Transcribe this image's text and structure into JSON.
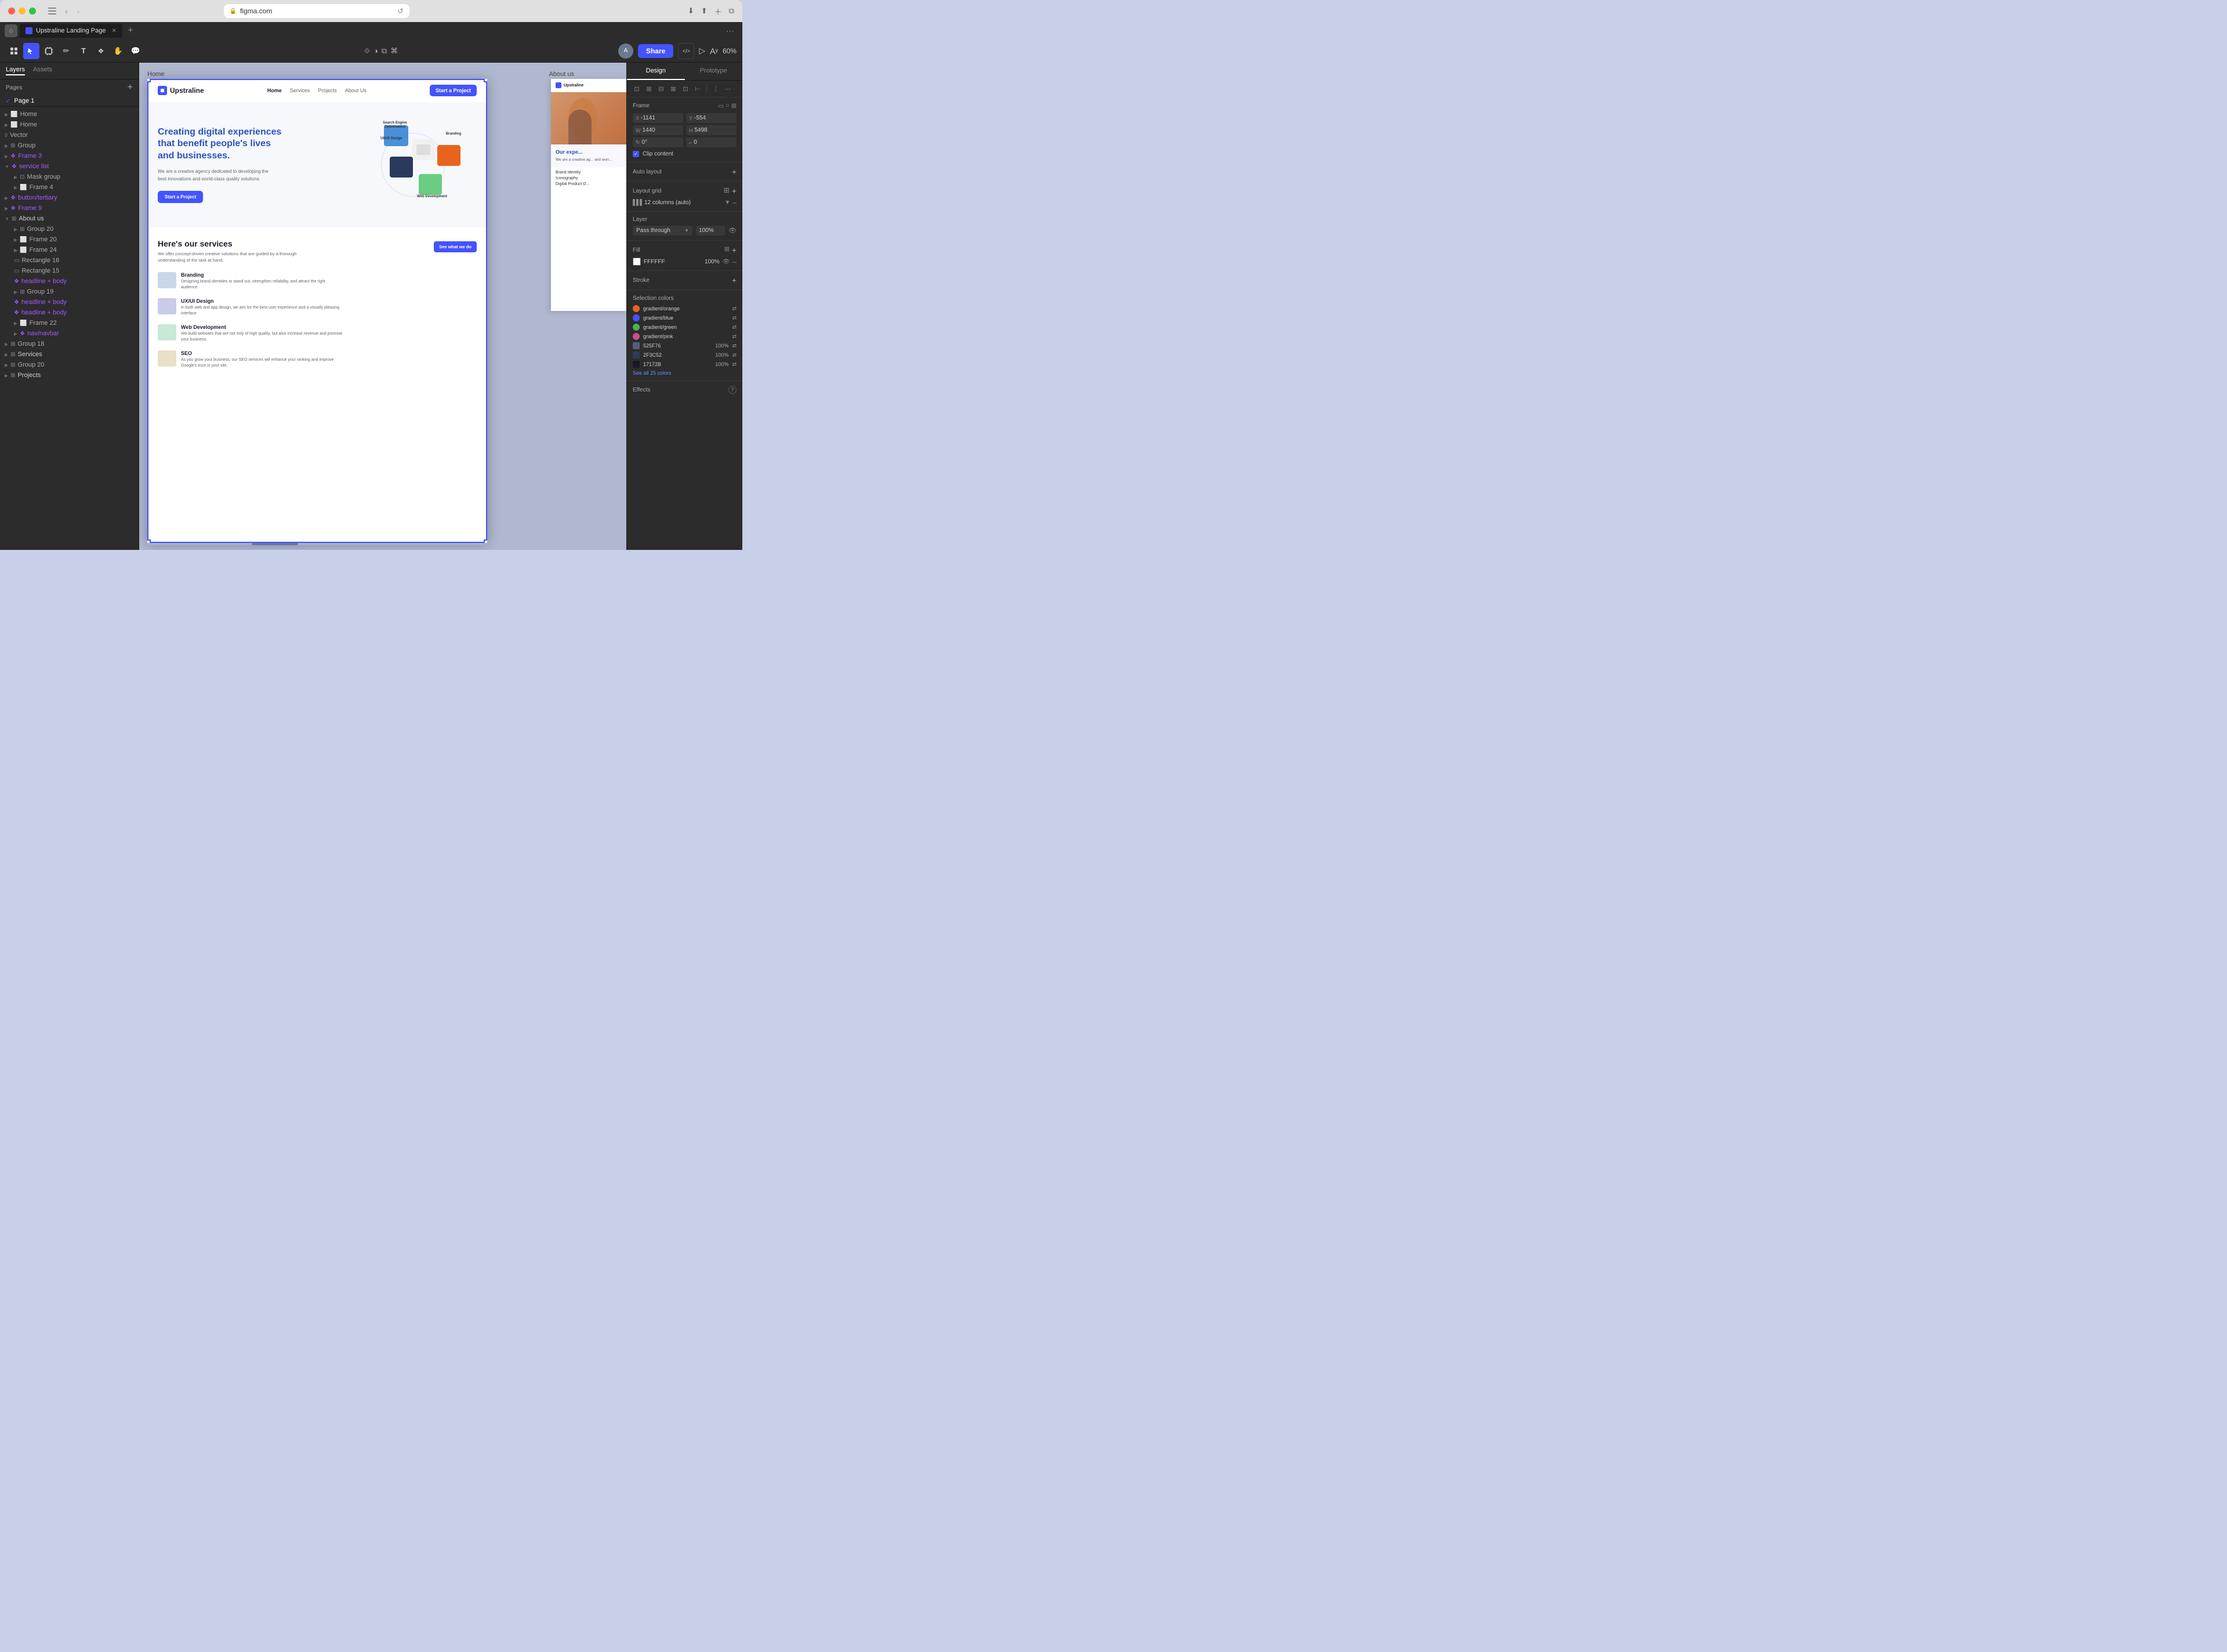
{
  "browser": {
    "url": "figma.com",
    "tab_title": "Upstraline Landing Page",
    "reload_icon": "↺"
  },
  "toolbar": {
    "tool_select": "▲",
    "tool_frame": "⬜",
    "tool_pen": "✏",
    "tool_text": "T",
    "tool_component": "❖",
    "tool_hand": "✋",
    "tool_comment": "💬",
    "share_label": "Share",
    "zoom_label": "60%",
    "present_icon": "▷",
    "code_icon": "</>",
    "avatar_label": "A"
  },
  "left_panel": {
    "tabs": [
      "Layers",
      "Assets"
    ],
    "current_page": "Page 1",
    "pages_label": "Pages",
    "layers": [
      {
        "id": "home1",
        "label": "Home",
        "icon": "frame",
        "indent": 0
      },
      {
        "id": "home2",
        "label": "Home",
        "icon": "frame",
        "indent": 0
      },
      {
        "id": "vector",
        "label": "Vector",
        "icon": "path",
        "indent": 0
      },
      {
        "id": "group",
        "label": "Group",
        "icon": "group",
        "indent": 0
      },
      {
        "id": "frame3",
        "label": "Frame 3",
        "icon": "component",
        "indent": 0
      },
      {
        "id": "service_list",
        "label": "service list",
        "icon": "component",
        "indent": 0
      },
      {
        "id": "mask_group",
        "label": "Mask group",
        "icon": "group",
        "indent": 1
      },
      {
        "id": "frame4",
        "label": "Frame 4",
        "icon": "frame",
        "indent": 1
      },
      {
        "id": "button_tertiary",
        "label": "button/tertiary",
        "icon": "component",
        "indent": 0
      },
      {
        "id": "frame9",
        "label": "Frame 9",
        "icon": "component",
        "indent": 0
      },
      {
        "id": "about_us",
        "label": "About us",
        "icon": "group",
        "indent": 0
      },
      {
        "id": "group20",
        "label": "Group 20",
        "icon": "group",
        "indent": 1
      },
      {
        "id": "frame20",
        "label": "Frame 20",
        "icon": "frame",
        "indent": 1
      },
      {
        "id": "frame24",
        "label": "Frame 24",
        "icon": "frame",
        "indent": 1
      },
      {
        "id": "rect16",
        "label": "Rectangle 16",
        "icon": "rect",
        "indent": 1
      },
      {
        "id": "rect15",
        "label": "Rectangle 15",
        "icon": "rect",
        "indent": 1
      },
      {
        "id": "headline_body",
        "label": "headline + body",
        "icon": "component",
        "indent": 1
      },
      {
        "id": "group19",
        "label": "Group 19",
        "icon": "group",
        "indent": 1
      },
      {
        "id": "headline_body2",
        "label": "headline + body",
        "icon": "component",
        "indent": 1
      },
      {
        "id": "headline_body3",
        "label": "headline + body",
        "icon": "component",
        "indent": 1
      },
      {
        "id": "frame22",
        "label": "Frame 22",
        "icon": "frame",
        "indent": 1
      },
      {
        "id": "nav_navbar",
        "label": "nav/navbar",
        "icon": "component",
        "indent": 1
      },
      {
        "id": "group18",
        "label": "Group 18",
        "icon": "group",
        "indent": 0
      },
      {
        "id": "services",
        "label": "Services",
        "icon": "group",
        "indent": 0
      },
      {
        "id": "group20b",
        "label": "Group 20",
        "icon": "group",
        "indent": 0
      },
      {
        "id": "projects",
        "label": "Projects",
        "icon": "group",
        "indent": 0
      }
    ]
  },
  "canvas": {
    "frame_label": "Home",
    "frame2_label": "About us"
  },
  "site": {
    "logo_text": "Upstraline",
    "nav_items": [
      "Home",
      "Services",
      "Projects",
      "About Us"
    ],
    "cta_button": "Start a Project",
    "hero_title": "Creating digital experiences that benefit people's lives and businesses.",
    "hero_sub": "We are a creative agency dedicated to developing the best innovations and world-class quality solutions.",
    "hero_btn": "Start a Project",
    "hero_labels": {
      "seo": "Search Engine Optimisation",
      "uiux": "UI/UX Design",
      "branding": "Branding",
      "web": "Web Development"
    },
    "services_title": "Here's our services",
    "services_sub": "We offer concept-driven creative solutions that are guided by a thorough understanding of the task at hand.",
    "see_what_btn": "See what we do",
    "services": [
      {
        "name": "Branding",
        "desc": "Designing brand identities to stand out, strengthen reliability, and attract the right audience."
      },
      {
        "name": "UX/UI Design",
        "desc": "In both web and app design, we aim for the best user experience and a visually pleasing interface"
      },
      {
        "name": "Web Development",
        "desc": "We build websites that are not only of high quality, but also increase revenue and promote your business."
      },
      {
        "name": "SEO",
        "desc": "As you grow your business, our SEO services will enhance your ranking and improve Google's trust in your site."
      }
    ]
  },
  "right_panel": {
    "tabs": [
      "Design",
      "Prototype"
    ],
    "active_tab": "Design",
    "frame_section": {
      "label": "Frame",
      "x": "-1141",
      "y": "-554",
      "w": "1440",
      "h": "5498",
      "r": "0°",
      "clip_content": "Clip content"
    },
    "auto_layout": {
      "label": "Auto layout"
    },
    "layout_grid": {
      "label": "Layout grid",
      "value": "12 columns (auto)"
    },
    "layer": {
      "label": "Layer",
      "blend": "Pass through",
      "opacity": "100%"
    },
    "fill": {
      "label": "Fill",
      "color": "#FFFFFF",
      "hex": "FFFFFF",
      "opacity": "100%"
    },
    "stroke": {
      "label": "Stroke"
    },
    "selection_colors": {
      "label": "Selection colors",
      "colors": [
        {
          "name": "gradient/orange",
          "hex": "#E8641C"
        },
        {
          "name": "gradient/blue",
          "hex": "#4353FF"
        },
        {
          "name": "gradient/green",
          "hex": "#4CAF50"
        },
        {
          "name": "gradient/pink",
          "hex": "#C8508A"
        },
        {
          "name": "525F76",
          "hex": "#525F76",
          "opacity": "100%"
        },
        {
          "name": "2F3C52",
          "hex": "#2F3C52",
          "opacity": "100%"
        },
        {
          "name": "17172B",
          "hex": "#17172B",
          "opacity": "100%"
        }
      ],
      "see_all": "See all 25 colors"
    },
    "effects": {
      "label": "Effects"
    }
  }
}
